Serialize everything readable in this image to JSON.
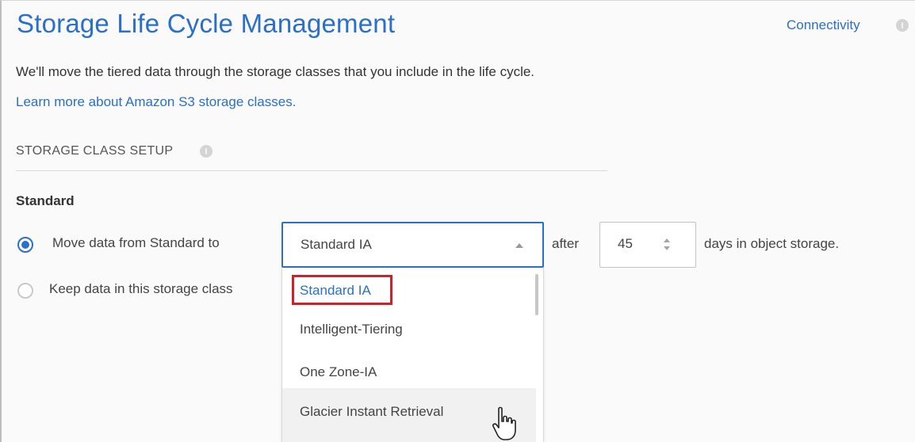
{
  "header": {
    "title": "Storage Life Cycle Management",
    "connectivity_link": "Connectivity"
  },
  "intro": {
    "description": "We'll move the tiered data through the storage classes that you include in the life cycle.",
    "learn_more": "Learn more about Amazon S3 storage classes."
  },
  "setup": {
    "section_title": "STORAGE CLASS SETUP",
    "class_name": "Standard",
    "move_option": {
      "label": "Move data from Standard to",
      "selected": true
    },
    "keep_option": {
      "label": "Keep data in this storage class",
      "selected": false
    },
    "storage_class_select": {
      "value": "Standard IA",
      "expanded": true,
      "options": [
        "Standard IA",
        "Intelligent-Tiering",
        "One Zone-IA",
        "Glacier Instant Retrieval"
      ],
      "highlighted_option": "Standard IA",
      "hovered_option": "Glacier Instant Retrieval"
    },
    "after_label": "after",
    "days_value": "45",
    "days_suffix": "days in object storage."
  },
  "icons": {
    "info": "info-icon",
    "caret": "chevron-up-icon",
    "stepper": "stepper-arrows-icon",
    "cursor": "hand-pointer-icon"
  },
  "colors": {
    "accent": "#2a6fc9",
    "highlight_box": "#c9242b",
    "hover_background": "#f1f1f1"
  }
}
